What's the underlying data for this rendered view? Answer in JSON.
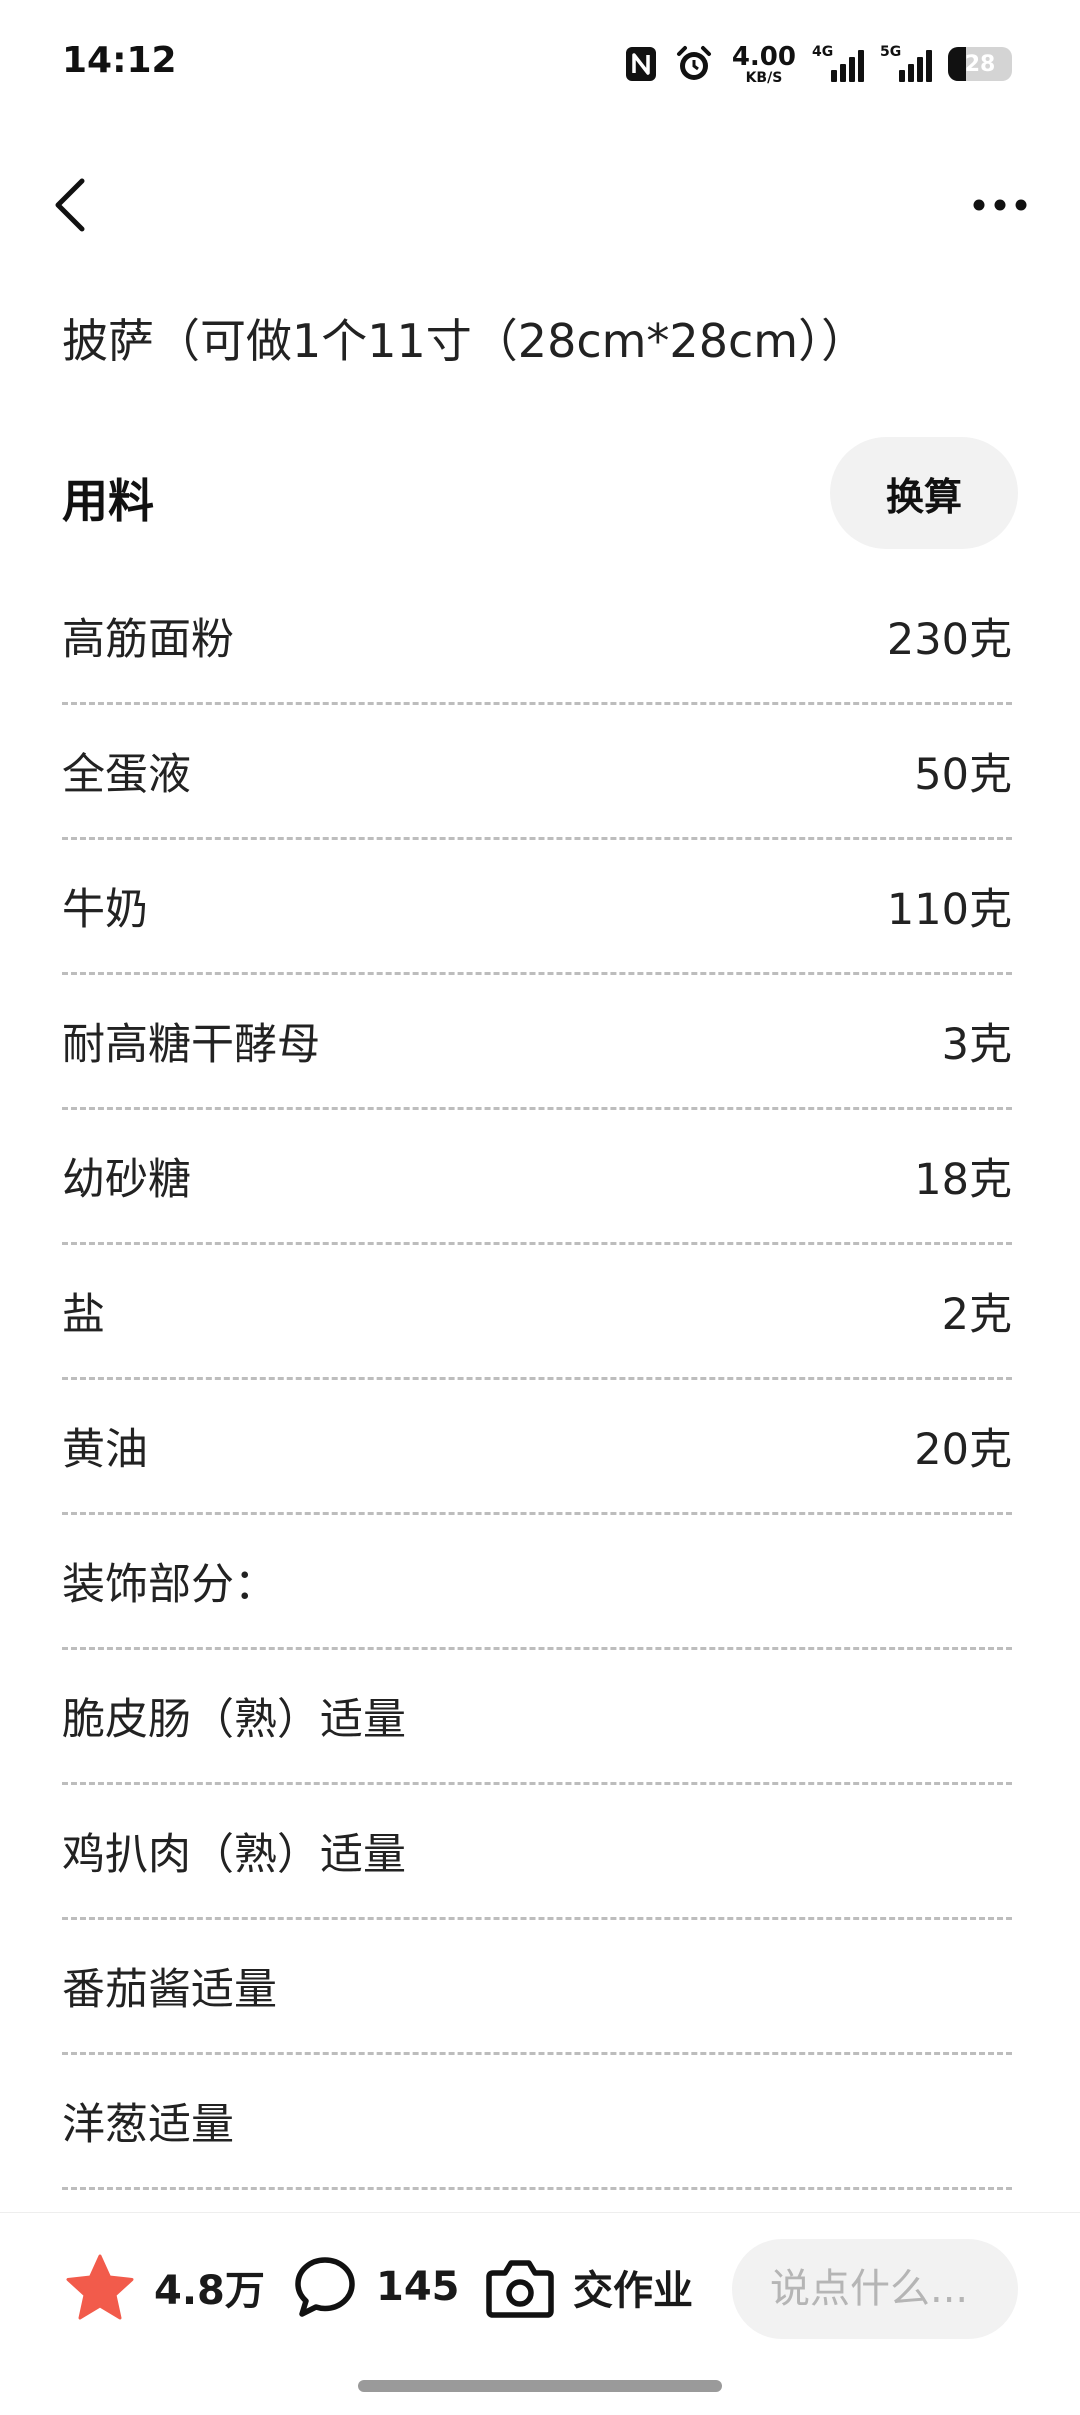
{
  "status_bar": {
    "time": "14:12",
    "network_speed_value": "4.00",
    "network_speed_unit": "KB/S",
    "signal_1_label": "4G",
    "signal_2_label": "5G",
    "battery_level": "28",
    "icons": [
      "nfc-icon",
      "alarm-icon",
      "signal-4g-icon",
      "signal-5g-icon",
      "battery-icon"
    ]
  },
  "nav": {
    "back_icon": "chevron-left-icon",
    "more_icon": "more-dots-icon"
  },
  "recipe": {
    "title": "披萨（可做1个11寸（28cm*28cm））"
  },
  "ingredients_section": {
    "title": "用料",
    "convert_button_label": "换算",
    "items": [
      {
        "name": "高筋面粉",
        "amount": "230克"
      },
      {
        "name": "全蛋液",
        "amount": "50克"
      },
      {
        "name": "牛奶",
        "amount": "110克"
      },
      {
        "name": "耐高糖干酵母",
        "amount": "3克"
      },
      {
        "name": "幼砂糖",
        "amount": "18克"
      },
      {
        "name": "盐",
        "amount": "2克"
      },
      {
        "name": "黄油",
        "amount": "20克"
      },
      {
        "name": "装饰部分：",
        "amount": ""
      },
      {
        "name": "脆皮肠（熟）适量",
        "amount": ""
      },
      {
        "name": "鸡扒肉（熟）适量",
        "amount": ""
      },
      {
        "name": "番茄酱适量",
        "amount": ""
      },
      {
        "name": "洋葱适量",
        "amount": ""
      }
    ]
  },
  "bottom_bar": {
    "favorite_count": "4.8万",
    "comment_count": "145",
    "homework_label": "交作业",
    "input_placeholder": "说点什么...",
    "accent_color": "#f25b4b"
  }
}
